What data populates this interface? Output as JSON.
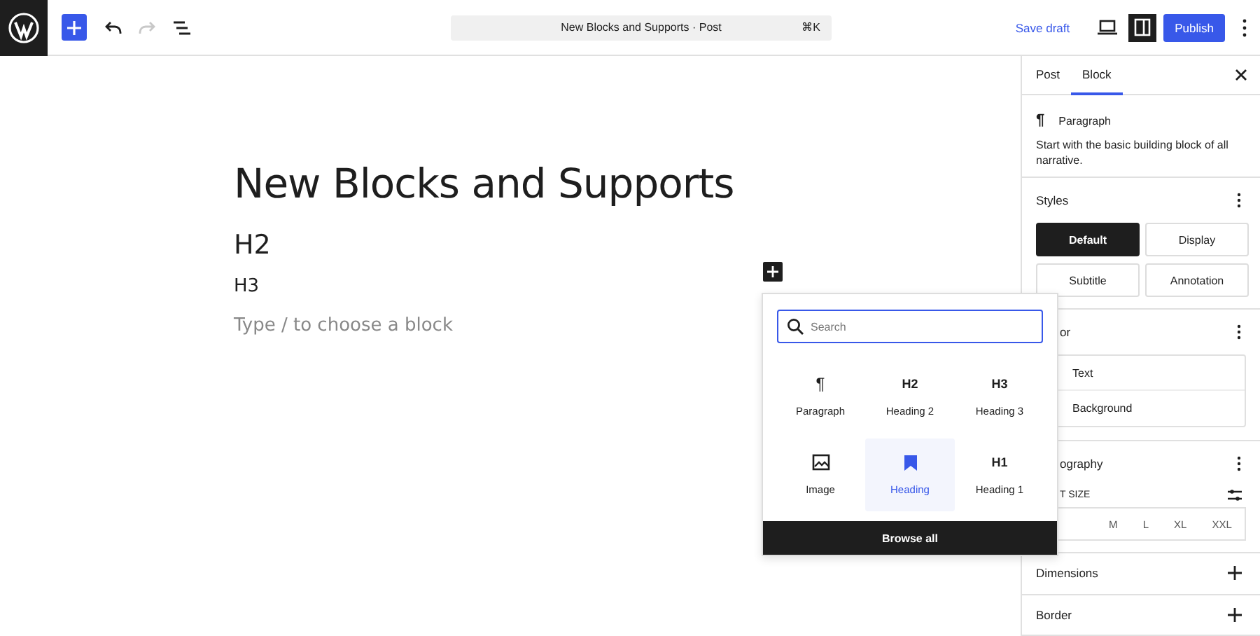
{
  "toolbar": {
    "inserter_open": false,
    "undo_disabled": false,
    "redo_disabled": true,
    "document_title": "New Blocks and Supports · Post",
    "shortcut": "⌘K",
    "save_label": "Save draft",
    "settings_selected": true,
    "publish_label": "Publish"
  },
  "editor": {
    "blocks": [
      {
        "kind": "title",
        "text": "New Blocks and Supports"
      },
      {
        "kind": "h2",
        "text": "H2"
      },
      {
        "kind": "h3",
        "text": "H3"
      },
      {
        "kind": "placeholder",
        "text": "Type / to choose a block"
      }
    ]
  },
  "inserter": {
    "search": {
      "placeholder": "Search"
    },
    "items": [
      {
        "kind": "paragraph",
        "label": "Paragraph",
        "glyph": "¶",
        "selected": false
      },
      {
        "kind": "text",
        "label": "Heading 2",
        "glyph": "H2",
        "selected": false
      },
      {
        "kind": "text",
        "label": "Heading 3",
        "glyph": "H3",
        "selected": false
      },
      {
        "kind": "image",
        "label": "Image",
        "selected": false
      },
      {
        "kind": "bookmark",
        "label": "Heading",
        "selected": true
      },
      {
        "kind": "text",
        "label": "Heading 1",
        "glyph": "H1",
        "selected": false
      }
    ],
    "browse_label": "Browse all"
  },
  "sidebar": {
    "tabs": [
      {
        "label": "Post",
        "selected": false
      },
      {
        "label": "Block",
        "selected": true
      }
    ],
    "block": {
      "glyph": "¶",
      "name": "Paragraph",
      "description": "Start with the basic building block of all narrative."
    },
    "styles": {
      "title": "Styles",
      "options": [
        {
          "label": "Default",
          "selected": true
        },
        {
          "label": "Display",
          "selected": false
        },
        {
          "label": "Subtitle",
          "selected": false
        },
        {
          "label": "Annotation",
          "selected": false
        }
      ]
    },
    "color": {
      "title": "or",
      "items": [
        "Text",
        "Background"
      ]
    },
    "typography": {
      "title": "ography",
      "font_size_label": "T SIZE",
      "sizes": [
        "M",
        "L",
        "XL",
        "XXL"
      ]
    },
    "collapsed": [
      {
        "title": "Dimensions"
      },
      {
        "title": "Border"
      }
    ]
  }
}
